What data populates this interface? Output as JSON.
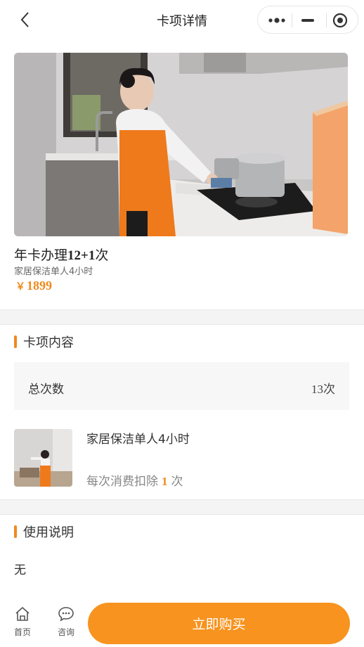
{
  "nav": {
    "title": "卡项详情"
  },
  "product": {
    "title_parts": [
      "年卡办理",
      "12+1",
      "次"
    ],
    "subtitle": "家居保洁单人4小时",
    "currency": "￥",
    "price": "1899"
  },
  "card_content": {
    "section_title": "卡项内容",
    "total_label": "总次数",
    "total_value": "13次",
    "item": {
      "name": "家居保洁单人4小时",
      "deduct_prefix": "每次消费扣除",
      "deduct_num": "1",
      "deduct_suffix": "次"
    }
  },
  "usage": {
    "section_title": "使用说明",
    "text": "无"
  },
  "bottom": {
    "home_label": "首页",
    "consult_label": "咨询",
    "buy_label": "立即购买"
  },
  "colors": {
    "accent": "#f7931e",
    "price": "#f08a1c"
  },
  "icons": {
    "back": "chevron-left-icon",
    "more": "more-dots-icon",
    "minimize": "minimize-icon",
    "close": "target-icon",
    "home": "home-icon",
    "consult": "chat-bubble-icon"
  }
}
